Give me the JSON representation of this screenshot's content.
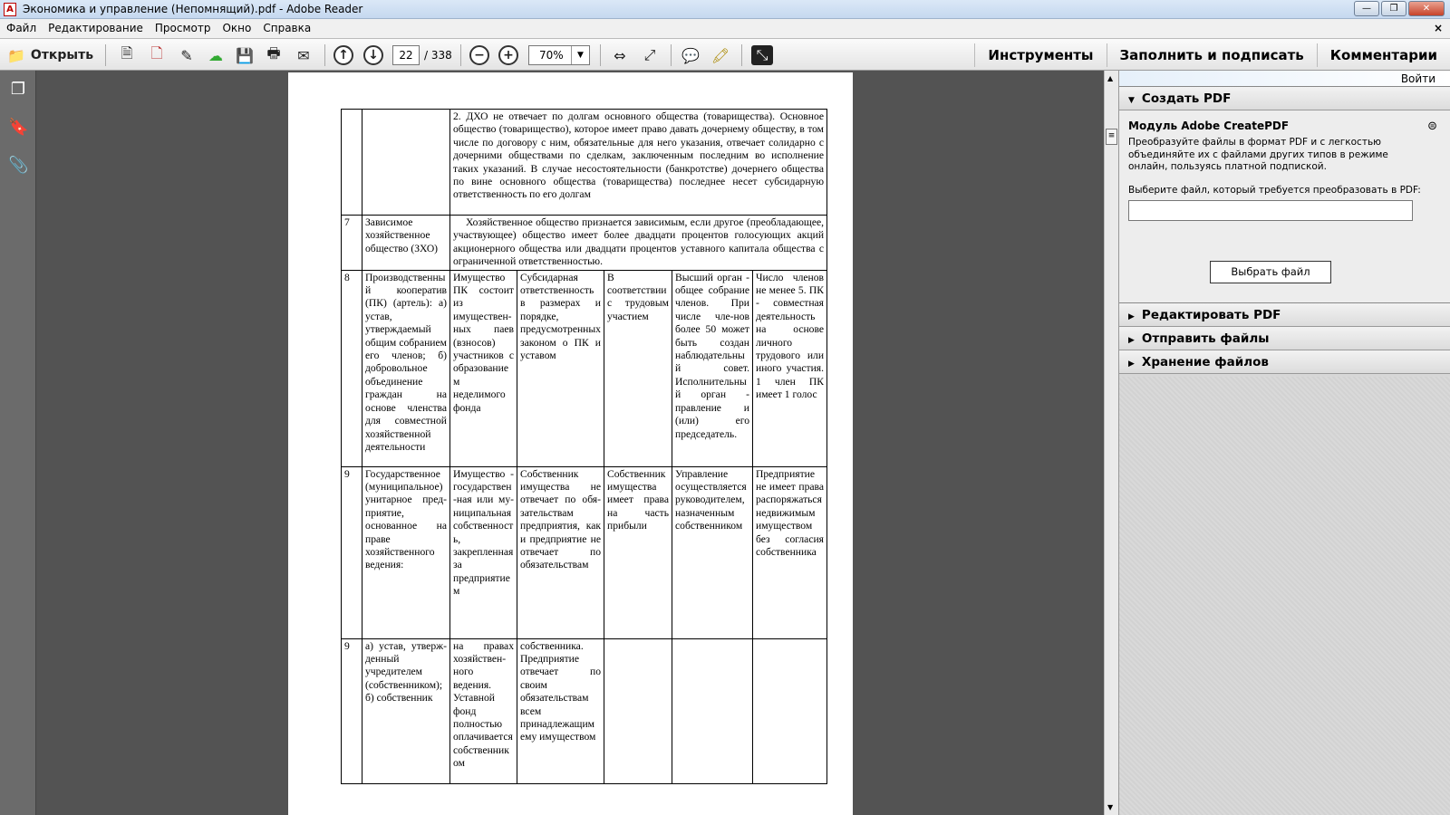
{
  "window": {
    "title": "Экономика и управление (Непомнящий).pdf - Adobe Reader",
    "min": "—",
    "max": "❐",
    "close": "✕"
  },
  "menu": [
    "Файл",
    "Редактирование",
    "Просмотр",
    "Окно",
    "Справка"
  ],
  "menu_close": "×",
  "toolbar": {
    "open_label": "Открыть",
    "page_current": "22",
    "page_total": "/ 338",
    "zoom": "70%",
    "tools": "Инструменты",
    "fill_sign": "Заполнить и подписать",
    "comments": "Комментарии"
  },
  "right_panel": {
    "login": "Войти",
    "create_pdf": "Создать PDF",
    "module_title": "Модуль Adobe CreatePDF",
    "module_desc": "Преобразуйте файлы в формат PDF и с легкостью объединяйте их с файлами других типов в режиме онлайн, пользуясь платной подпиской.",
    "choose_label": "Выберите файл, который требуется преобразовать в PDF:",
    "choose_button": "Выбрать файл",
    "sections": [
      "Редактировать PDF",
      "Отправить файлы",
      "Хранение файлов"
    ]
  },
  "document": {
    "row1": {
      "num": "",
      "name": "",
      "text": "2. ДХО не отвечает по долгам основного общества (товарищества). Основное общество (товарищество), которое имеет право давать дочернему обществу, в том числе по договору с ним, обязательные для него указания, отвечает солидарно с дочерними обществами по сделкам, заключенным последним во исполнение таких указаний. В случае несостоятельности (банкротстве) дочернего общества по вине основного общества (товарищества) последнее несет субсидарную ответственность по его долгам"
    },
    "row2": {
      "num": "7",
      "name": "Зависимое хозяйственное общество (ЗХО)",
      "text": "Хозяйственное общество признается зависимым, если другое (преобладающее, участвующее) общество имеет более двадцати процентов голосующих акций акционерного общества или двадцати процентов уставного капитала общества с ограниченной ответственностью."
    },
    "row3": {
      "num": "8",
      "cells": [
        "Производственный кооператив (ПК) (артель): а) устав, утверждаемый общим собранием его членов; б) добровольное объединение граждан на основе членства для совместной хозяйственной деятельности",
        "Имущество ПК состоит из имуществен-ных паев (взносов) участников с образованием неделимого фонда",
        "Субсидарная ответственность в размерах и порядке, предусмотренных законом о ПК и уставом",
        "В соответствии с трудовым участием",
        "Высший орган - общее собрание членов. При числе чле-нов более 50 может быть создан наблюдательный совет. Исполнительный орган - правление и (или) его председатель.",
        "Число членов не менее 5. ПК - совместная деятельность на основе личного трудового или иного участия. 1 член ПК имеет 1 голос"
      ]
    },
    "row4": {
      "num": "9",
      "cells": [
        "Государственное (муниципальное) унитарное пред-приятие, основанное на праве хозяйственного ведения:",
        "Имущество - государствен-ная или му-ниципальная собственность, закрепленная за предприятием",
        "Собственник имущества не отвечает по обя-зательствам предприятия, как и предприятие не отвечает по обязательствам",
        "Собственник имущества имеет права на часть прибыли",
        "Управление осуществляется руководителем, назначенным собственником",
        "Предприятие не имеет права распоряжаться недвижимым имуществом без согласия собственника"
      ]
    },
    "row5": {
      "num": "9",
      "cells": [
        "а) устав, утверж-денный учредителем (собственником); б) собственник",
        "на правах хозяйствен-ного ведения. Уставной фонд полностью оплачивается собственником",
        "собственника. Предприятие отвечает по своим обязательствам всем принадлежащим ему имуществом",
        "",
        "",
        ""
      ]
    }
  }
}
